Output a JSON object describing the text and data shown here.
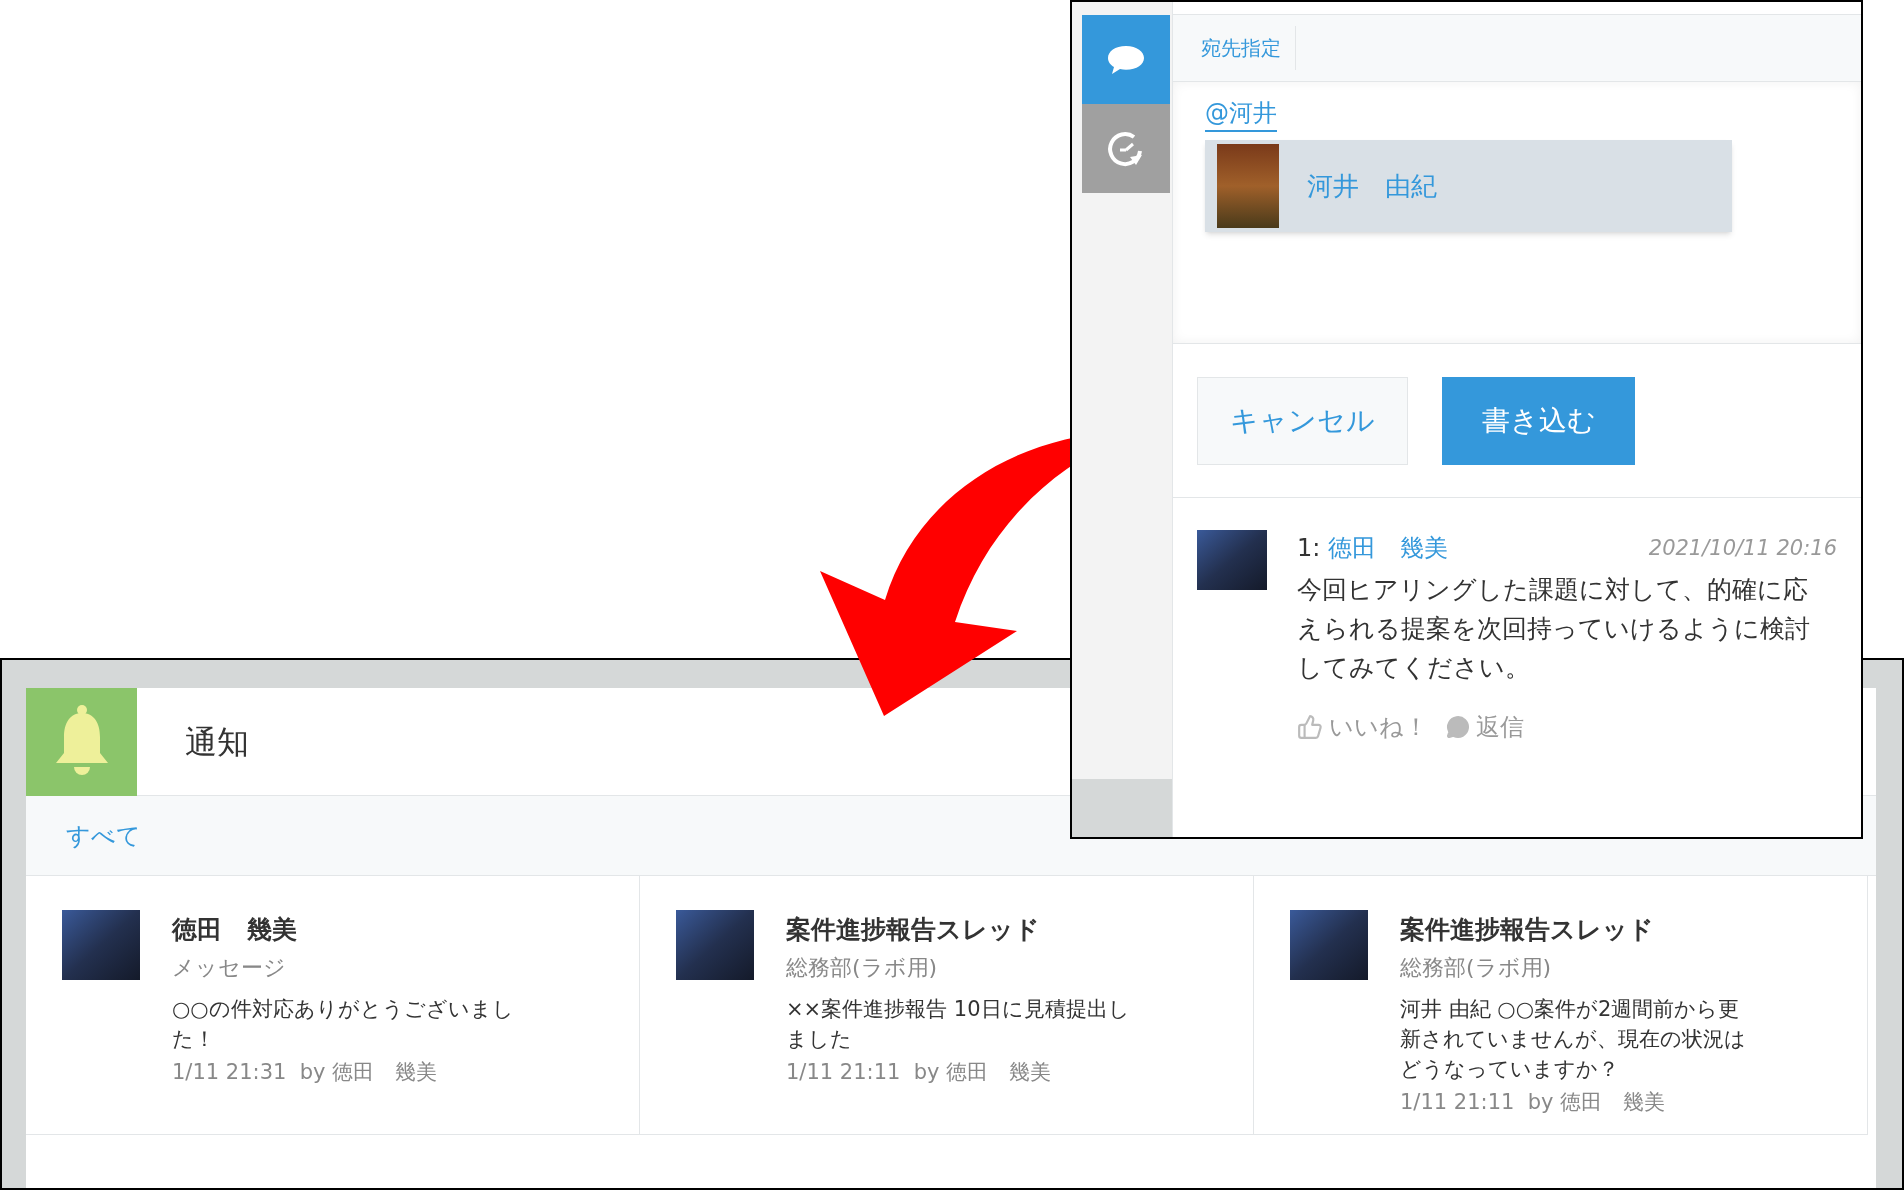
{
  "compose_panel": {
    "tabs": [
      {
        "kind": "comment",
        "selected": true
      },
      {
        "kind": "history",
        "selected": false
      }
    ],
    "toolbar": {
      "mention_button": "宛先指定"
    },
    "editor": {
      "value": "@河井"
    },
    "suggestions": [
      {
        "name": "河井　由紀",
        "selected": true
      }
    ],
    "buttons": {
      "cancel": "キャンセル",
      "submit": "書き込む"
    },
    "comments": [
      {
        "number": "1:",
        "author": "徳田　幾美",
        "timestamp": "2021/10/11 20:16",
        "body": "今回ヒアリングした課題に対して、的確に応えられる提案を次回持っていけるように検討してみてください。",
        "like": "いいね！",
        "reply": "返信"
      }
    ]
  },
  "notifications": {
    "title": "通知",
    "filters": [
      {
        "label": "すべて",
        "selected": true
      }
    ],
    "items": [
      {
        "title": "徳田　幾美",
        "subtitle": "メッセージ",
        "body": "○○の件対応ありがとうございました！",
        "meta": "1/11 21:31  by 徳田　幾美"
      },
      {
        "title": "案件進捗報告スレッド",
        "subtitle": "総務部(ラボ用)",
        "body": "××案件進捗報告 10日に見積提出しました",
        "meta": "1/11 21:11  by 徳田　幾美"
      },
      {
        "title": "案件進捗報告スレッド",
        "subtitle": "総務部(ラボ用)",
        "body": "河井 由紀 ○○案件が2週間前から更新されていませんが、現在の状況はどうなっていますか？",
        "meta": "1/11 21:11  by 徳田　幾美"
      }
    ]
  }
}
